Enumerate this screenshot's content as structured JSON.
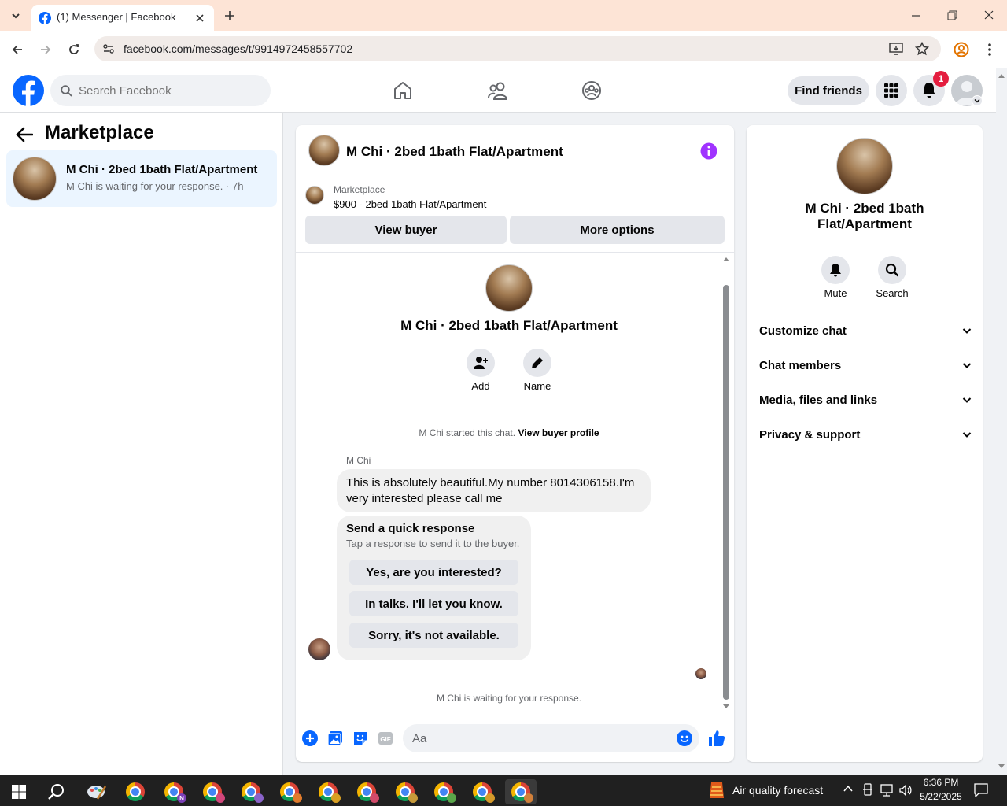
{
  "browser": {
    "tab_title": "(1) Messenger | Facebook",
    "url": "facebook.com/messages/t/9914972458557702"
  },
  "fb": {
    "search_placeholder": "Search Facebook",
    "find_friends": "Find friends",
    "notif_count": "1"
  },
  "left": {
    "title": "Marketplace",
    "conversation": {
      "name": "M Chi · 2bed 1bath Flat/Apartment",
      "preview": "M Chi is waiting for your response. · 7h"
    }
  },
  "chat": {
    "header_title": "M Chi · 2bed 1bath Flat/Apartment",
    "listing_source": "Marketplace",
    "listing_title": "$900 - 2bed 1bath Flat/Apartment",
    "view_buyer": "View buyer",
    "more_options": "More options",
    "intro_name": "M Chi · 2bed 1bath Flat/Apartment",
    "add_label": "Add",
    "name_label": "Name",
    "started_text": "M Chi started this chat.",
    "view_buyer_profile": "View buyer profile",
    "sender": "M Chi",
    "message": "This is absolutely beautiful.My number 8014306158.I'm very interested please call me",
    "quick_title": "Send a quick response",
    "quick_sub": "Tap a response to send it to the buyer.",
    "quick_responses": [
      "Yes, are you interested?",
      "In talks. I'll let you know.",
      "Sorry, it's not available."
    ],
    "waiting_text": "M Chi is waiting for your response.",
    "composer_placeholder": "Aa"
  },
  "right": {
    "name": "M Chi · 2bed 1bath Flat/Apartment",
    "mute": "Mute",
    "search": "Search",
    "sections": [
      "Customize chat",
      "Chat members",
      "Media, files and links",
      "Privacy & support"
    ]
  },
  "taskbar": {
    "weather": "Air quality forecast",
    "time": "6:36 PM",
    "date": "5/22/2025"
  },
  "colors": {
    "fb_blue": "#0866ff",
    "accent_purple": "#a033ff",
    "notif_red": "#e41e3f"
  }
}
